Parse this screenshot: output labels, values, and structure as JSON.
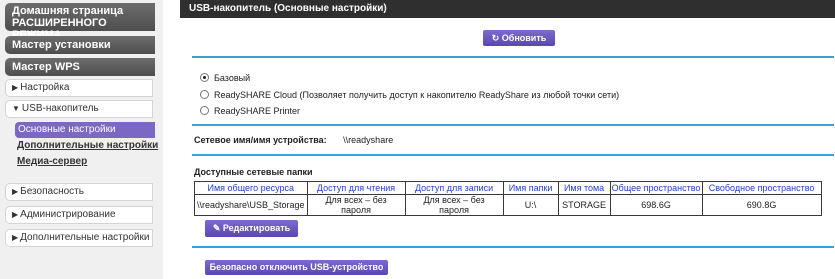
{
  "sidebar": {
    "home_label_line1": "Домашняя страница",
    "home_label_line2": "РАСШИРЕННОГО РЕЖИМА",
    "setup_wizard": "Мастер установки",
    "wps_wizard": "Мастер WPS",
    "setup": "Настройка",
    "usb_storage": "USB-накопитель",
    "usb_sub": {
      "basic": "Основные настройки",
      "advanced": "Дополнительные настройки",
      "media": "Медиа-сервер"
    },
    "security": "Безопасность",
    "administration": "Администрирование",
    "advanced_setup": "Дополнительные настройки"
  },
  "header": {
    "title": "USB-накопитель (Основные настройки)"
  },
  "toolbar": {
    "refresh_label": "Обновить"
  },
  "modes": [
    {
      "label": "Базовый",
      "checked": true
    },
    {
      "label": "ReadySHARE Cloud (Позволяет получить доступ к накопителю ReadyShare из любой точки сети)",
      "checked": false
    },
    {
      "label": "ReadySHARE Printer",
      "checked": false
    }
  ],
  "device": {
    "label": "Сетевое имя/имя устройства:",
    "value": "\\\\readyshare"
  },
  "shares": {
    "title": "Доступные сетевые папки",
    "columns": [
      "Имя общего ресурса",
      "Доступ для чтения",
      "Доступ для записи",
      "Имя папки",
      "Имя тома",
      "Общее пространство",
      "Свободное пространство"
    ],
    "rows": [
      [
        "\\\\readyshare\\USB_Storage",
        "Для всех – без пароля",
        "Для всех – без пароля",
        "U:\\",
        "STORAGE",
        "698.6G",
        "690.8G"
      ]
    ]
  },
  "actions": {
    "edit_label": "Редактировать",
    "eject_label": "Безопасно отключить USB-устройство"
  },
  "colors": {
    "accent_purple": "#6a56c0",
    "rule_blue": "#3a9fd8",
    "header_dark": "#2f2f2f"
  }
}
